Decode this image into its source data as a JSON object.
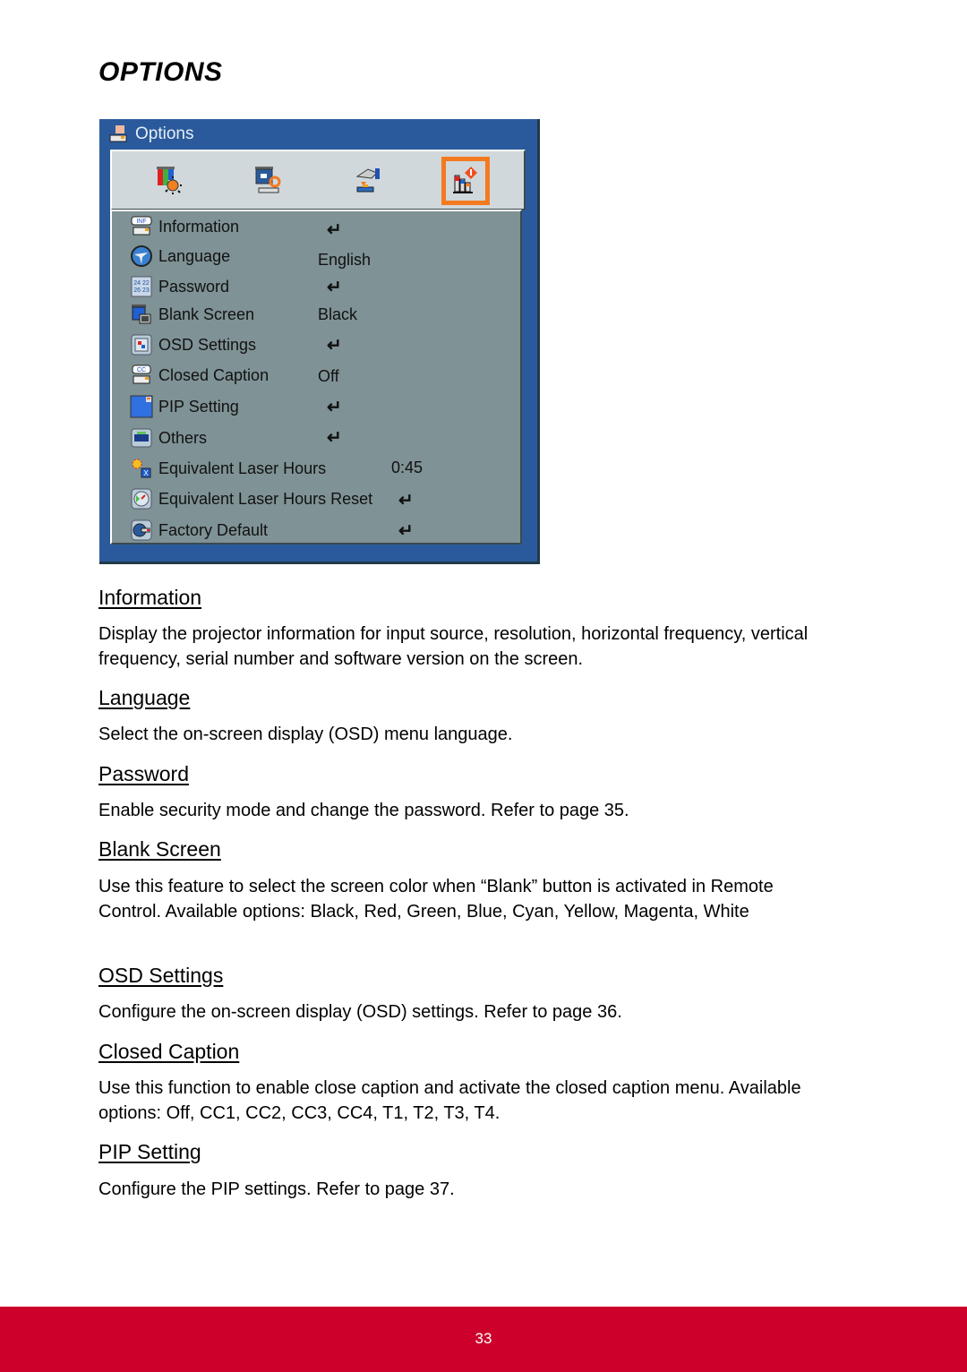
{
  "page_title": "OPTIONS",
  "osd": {
    "title": "Options",
    "header_icon": "projector-icon",
    "tabs": [
      {
        "icon": "picture-icon",
        "selected": false
      },
      {
        "icon": "display-icon",
        "selected": false
      },
      {
        "icon": "setting-icon",
        "selected": false
      },
      {
        "icon": "options-icon",
        "selected": true
      }
    ],
    "accent_color": "#f47a20",
    "items": [
      {
        "label": "Information",
        "icon": "info-icon",
        "value": "↵"
      },
      {
        "label": "Language",
        "icon": "globe-icon",
        "value": "English"
      },
      {
        "label": "Password",
        "icon": "keypad-icon",
        "value": "↵"
      },
      {
        "label": "Blank Screen",
        "icon": "blank-screen-icon",
        "value": "Black"
      },
      {
        "label": "OSD Settings",
        "icon": "osd-settings-icon",
        "value": "↵"
      },
      {
        "label": "Closed Caption",
        "icon": "closed-caption-icon",
        "value": "Off"
      },
      {
        "label": "PIP Setting",
        "icon": "pip-icon",
        "value": "↵"
      },
      {
        "label": "Others",
        "icon": "others-icon",
        "value": "↵"
      },
      {
        "label": "Equivalent Laser Hours",
        "icon": "laser-hours-icon",
        "value": "0:45"
      },
      {
        "label": "Equivalent Laser Hours Reset",
        "icon": "laser-reset-icon",
        "value": "↵"
      },
      {
        "label": "Factory Default",
        "icon": "factory-default-icon",
        "value": "↵"
      }
    ]
  },
  "sections": [
    {
      "heading": "Information",
      "body": "Display the projector information for input source, resolution, horizontal frequency, vertical frequency, serial number and software version on the screen."
    },
    {
      "heading": "Language",
      "body": "Select the on-screen display (OSD) menu language."
    },
    {
      "heading": "Password",
      "body": "Enable security mode and change the password. Refer to page 35."
    },
    {
      "heading": "Blank Screen",
      "body": "Use this feature to select the screen color when “Blank” button is activated in Remote Control. Available options: Black, Red, Green, Blue, Cyan, Yellow, Magenta, White"
    },
    {
      "heading": "OSD Settings",
      "body": "Configure the on-screen display (OSD) settings. Refer to page 36."
    },
    {
      "heading": "Closed Caption",
      "body": "Use this function to enable close caption and activate the closed caption menu. Available options: Off, CC1, CC2, CC3, CC4, T1, T2, T3, T4."
    },
    {
      "heading": "PIP Setting",
      "body": "Configure the PIP settings. Refer to page 37."
    }
  ],
  "footer": {
    "page_number": "33",
    "color": "#cc002a"
  }
}
